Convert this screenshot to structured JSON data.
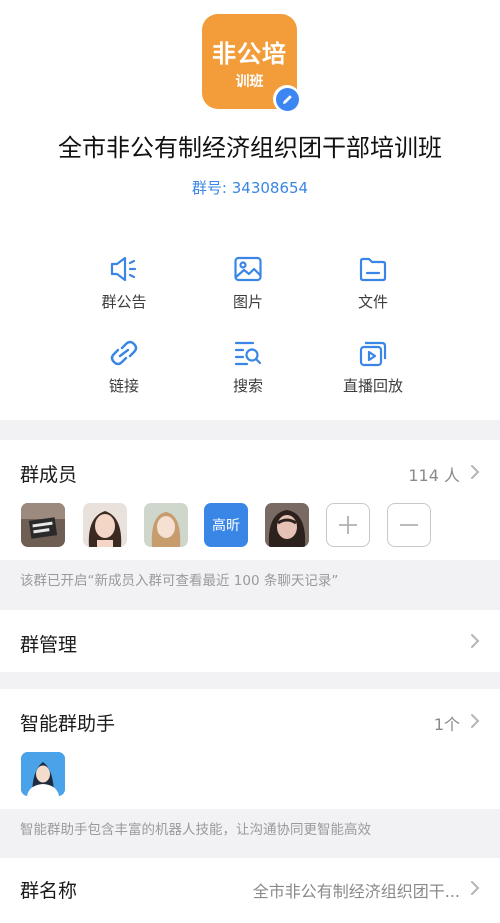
{
  "group": {
    "avatar_line1": "非公培",
    "avatar_line2": "训班",
    "name": "全市非公有制经济组织团干部培训班",
    "number_label": "群号: 34308654"
  },
  "actions": [
    {
      "label": "群公告",
      "icon": "megaphone-icon"
    },
    {
      "label": "图片",
      "icon": "image-icon"
    },
    {
      "label": "文件",
      "icon": "folder-icon"
    },
    {
      "label": "链接",
      "icon": "link-icon"
    },
    {
      "label": "搜索",
      "icon": "search-list-icon"
    },
    {
      "label": "直播回放",
      "icon": "video-playback-icon"
    }
  ],
  "members": {
    "title": "群成员",
    "count": "114 人",
    "avatars": [
      "member-photo",
      "member-photo",
      "member-photo",
      "高昕",
      "member-photo"
    ],
    "note": "该群已开启“新成员入群可查看最近 100 条聊天记录”"
  },
  "management": {
    "title": "群管理"
  },
  "assistant": {
    "title": "智能群助手",
    "count": "1个",
    "note": "智能群助手包含丰富的机器人技能，让沟通协同更智能高效"
  },
  "group_name_row": {
    "title": "群名称",
    "value": "全市非公有制经济组织团干..."
  },
  "colors": {
    "accent": "#3a86e6",
    "avatar_orange": "#f29c3a",
    "background": "#f2f2f5"
  }
}
